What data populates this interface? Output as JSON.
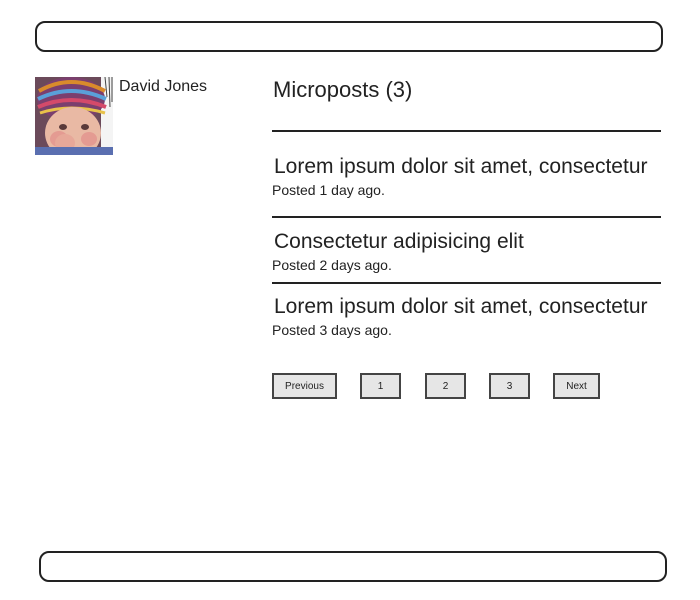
{
  "profile": {
    "name": "David Jones"
  },
  "microposts": {
    "heading": "Microposts (3)",
    "items": [
      {
        "content": "Lorem ipsum dolor sit amet, consectetur",
        "meta": "Posted 1 day ago."
      },
      {
        "content": "Consectetur adipisicing elit",
        "meta": "Posted 2 days ago."
      },
      {
        "content": "Lorem ipsum dolor sit amet, consectetur",
        "meta": "Posted 3 days ago."
      }
    ]
  },
  "pagination": {
    "previous": "Previous",
    "pages": [
      "1",
      "2",
      "3"
    ],
    "next": "Next"
  }
}
